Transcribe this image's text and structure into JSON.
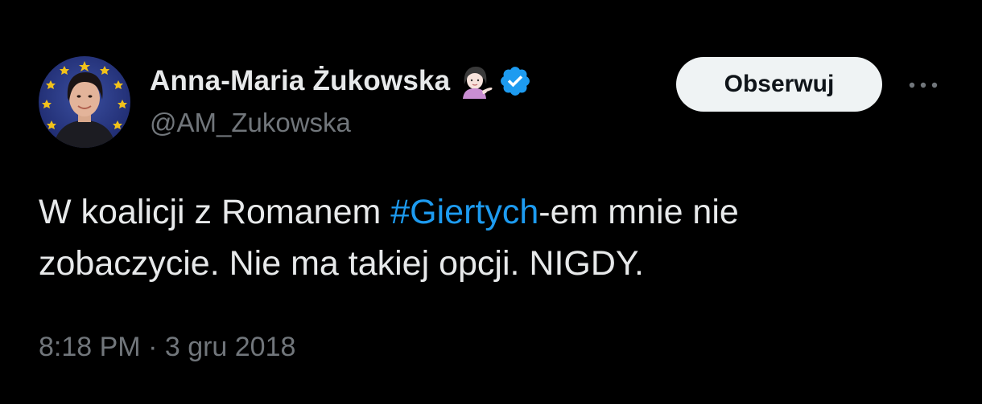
{
  "author": {
    "display_name": "Anna-Maria Żukowska",
    "handle": "@AM_Zukowska",
    "emoji": "woman-tipping-hand-icon",
    "verified_icon": "verified-badge-icon",
    "verified_color": "#1d9bf0"
  },
  "actions": {
    "follow_label": "Obserwuj",
    "more_icon": "more-options-icon"
  },
  "tweet": {
    "text_before": "W koalicji z Romanem ",
    "hashtag": "#Giertych",
    "text_after": "-em mnie nie\nzobaczycie. Nie ma takiej opcji. NIGDY.",
    "hashtag_color": "#1d9bf0"
  },
  "meta": {
    "timestamp": "8:18 PM · 3 gru 2018"
  },
  "colors": {
    "background": "#000000",
    "primary_text": "#e7e9ea",
    "secondary_text": "#71767b",
    "button_bg": "#eff3f4"
  }
}
